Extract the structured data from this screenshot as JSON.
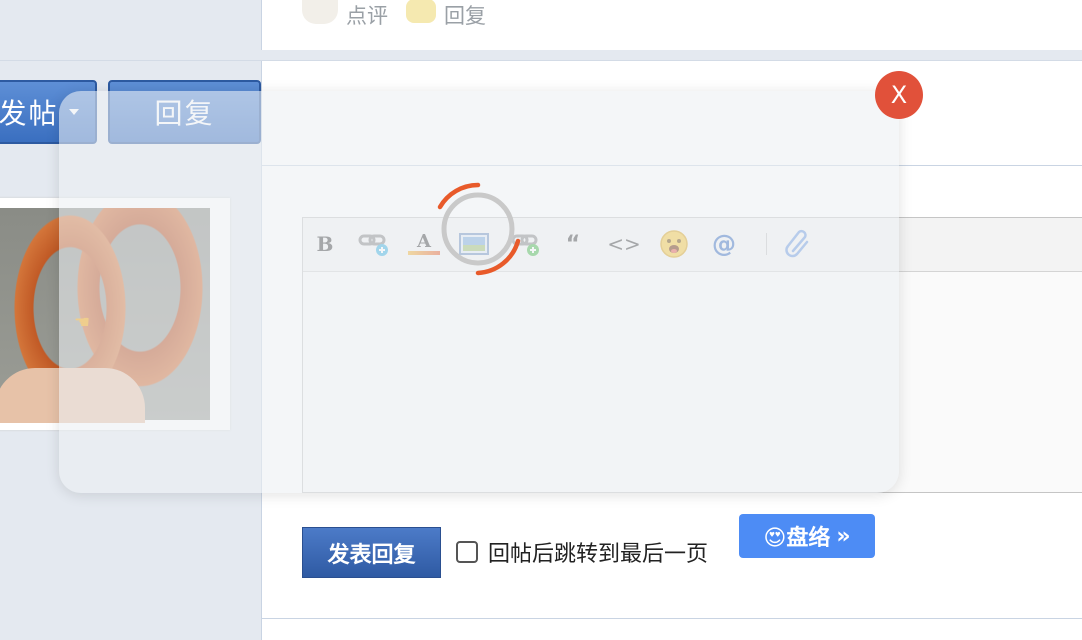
{
  "top_actions": {
    "comment_label": "点评",
    "reply_label": "回复"
  },
  "toolbar_buttons": {
    "post_label": "发帖",
    "reply_label": "回复"
  },
  "editor_toolbar": {
    "bold_label": "B",
    "font_color_label": "A",
    "quote_label": "“",
    "code_label": "<>",
    "mention_label": "@"
  },
  "footer": {
    "submit_label": "发表回复",
    "jump_label": "回帖后跳转到最后一页",
    "panluo_label": "😍盘络",
    "panluo_arrow": "»"
  },
  "overlay": {
    "close_label": "X"
  },
  "colors": {
    "accent_blue": "#3a6fc0",
    "close_red": "#e1513a",
    "panluo_blue": "#4d8cf5"
  }
}
